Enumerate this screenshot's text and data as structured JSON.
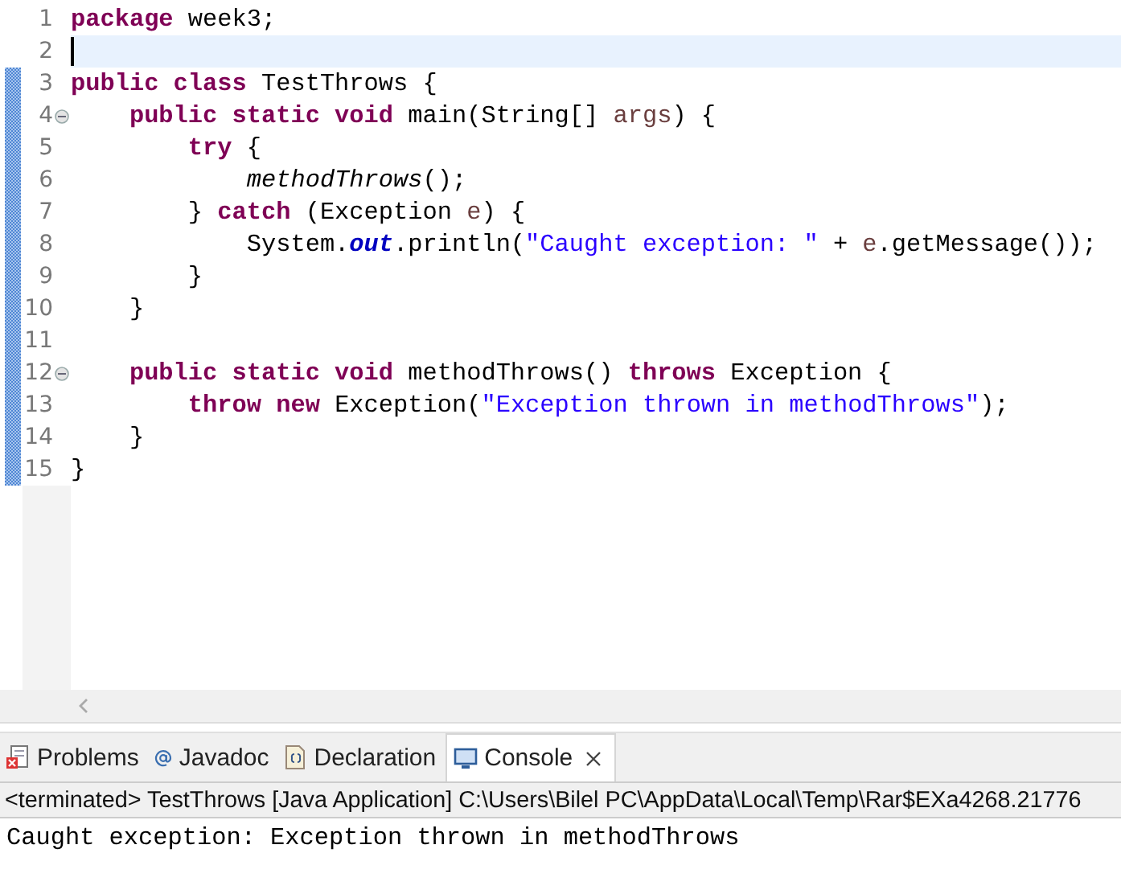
{
  "editor": {
    "lines": [
      {
        "number": "1",
        "fold": false,
        "changed": false,
        "current": false,
        "tokens": [
          {
            "t": "package",
            "kind": "keyword"
          },
          {
            "t": " week3;",
            "kind": "plain"
          }
        ]
      },
      {
        "number": "2",
        "fold": false,
        "changed": false,
        "current": true
      },
      {
        "number": "3",
        "fold": false,
        "changed": true,
        "current": false,
        "tokens": [
          {
            "t": "public class",
            "kind": "keyword"
          },
          {
            "t": " TestThrows {",
            "kind": "plain"
          }
        ]
      },
      {
        "number": "4",
        "fold": true,
        "changed": true,
        "current": false,
        "tokens": [
          {
            "t": "    public static void",
            "kind": "keyword"
          },
          {
            "t": " main(String[] ",
            "kind": "plain"
          },
          {
            "t": "args",
            "kind": "variable"
          },
          {
            "t": ") {",
            "kind": "plain"
          }
        ]
      },
      {
        "number": "5",
        "fold": false,
        "changed": true,
        "current": false,
        "tokens": [
          {
            "t": "        try",
            "kind": "keyword"
          },
          {
            "t": " {",
            "kind": "plain"
          }
        ]
      },
      {
        "number": "6",
        "fold": false,
        "changed": true,
        "current": false,
        "tokens": [
          {
            "t": "            methodThrows",
            "kind": "static-method"
          },
          {
            "t": "();",
            "kind": "plain"
          }
        ]
      },
      {
        "number": "7",
        "fold": false,
        "changed": true,
        "current": false,
        "tokens": [
          {
            "t": "        } ",
            "kind": "plain"
          },
          {
            "t": "catch",
            "kind": "keyword"
          },
          {
            "t": " (Exception ",
            "kind": "plain"
          },
          {
            "t": "e",
            "kind": "variable"
          },
          {
            "t": ") {",
            "kind": "plain"
          }
        ]
      },
      {
        "number": "8",
        "fold": false,
        "changed": true,
        "current": false,
        "tokens": [
          {
            "t": "            System.",
            "kind": "plain"
          },
          {
            "t": "out",
            "kind": "static-field"
          },
          {
            "t": ".println(",
            "kind": "plain"
          },
          {
            "t": "\"Caught exception: \"",
            "kind": "string"
          },
          {
            "t": " + ",
            "kind": "plain"
          },
          {
            "t": "e",
            "kind": "variable"
          },
          {
            "t": ".getMessage());",
            "kind": "plain"
          }
        ]
      },
      {
        "number": "9",
        "fold": false,
        "changed": true,
        "current": false,
        "tokens": [
          {
            "t": "        }",
            "kind": "plain"
          }
        ]
      },
      {
        "number": "10",
        "fold": false,
        "changed": true,
        "current": false,
        "tokens": [
          {
            "t": "    }",
            "kind": "plain"
          }
        ]
      },
      {
        "number": "11",
        "fold": false,
        "changed": true,
        "current": false
      },
      {
        "number": "12",
        "fold": true,
        "changed": true,
        "current": false,
        "tokens": [
          {
            "t": "    public static void",
            "kind": "keyword"
          },
          {
            "t": " methodThrows() ",
            "kind": "plain"
          },
          {
            "t": "throws",
            "kind": "keyword"
          },
          {
            "t": " Exception {",
            "kind": "plain"
          }
        ]
      },
      {
        "number": "13",
        "fold": false,
        "changed": true,
        "current": false,
        "tokens": [
          {
            "t": "        throw new",
            "kind": "keyword"
          },
          {
            "t": " Exception(",
            "kind": "plain"
          },
          {
            "t": "\"Exception thrown in methodThrows\"",
            "kind": "string"
          },
          {
            "t": ");",
            "kind": "plain"
          }
        ]
      },
      {
        "number": "14",
        "fold": false,
        "changed": true,
        "current": false,
        "tokens": [
          {
            "t": "    }",
            "kind": "plain"
          }
        ]
      },
      {
        "number": "15",
        "fold": false,
        "changed": true,
        "current": false,
        "tokens": [
          {
            "t": "}",
            "kind": "plain"
          }
        ]
      }
    ]
  },
  "bottom_panel": {
    "tabs": [
      {
        "label": "Problems",
        "kind": "problems",
        "selected": false,
        "closable": false
      },
      {
        "label": "Javadoc",
        "kind": "javadoc",
        "selected": false,
        "closable": false
      },
      {
        "label": "Declaration",
        "kind": "declaration",
        "selected": false,
        "closable": false
      },
      {
        "label": "Console",
        "kind": "console",
        "selected": true,
        "closable": true
      }
    ],
    "console_header": "<terminated> TestThrows [Java Application] C:\\Users\\Bilel PC\\AppData\\Local\\Temp\\Rar$EXa4268.21776",
    "console_output": "Caught exception: Exception thrown in methodThrows"
  }
}
